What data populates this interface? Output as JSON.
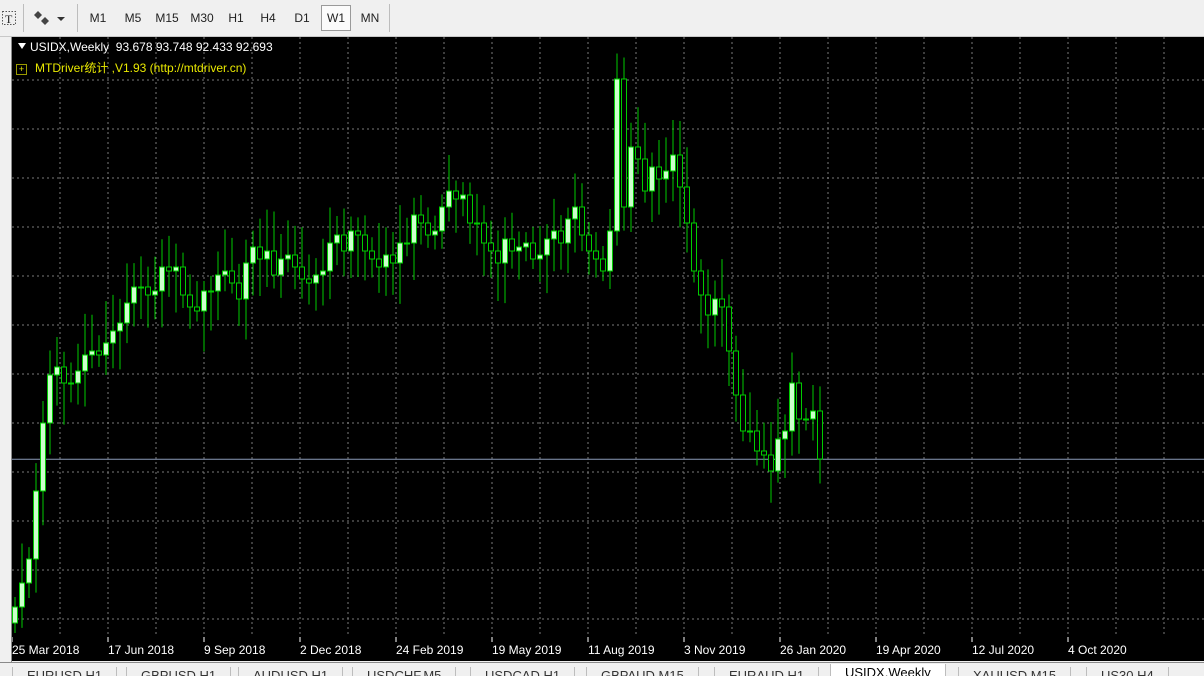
{
  "toolbar": {
    "timeframes": [
      {
        "label": "M1",
        "active": false
      },
      {
        "label": "M5",
        "active": false
      },
      {
        "label": "M15",
        "active": false
      },
      {
        "label": "M30",
        "active": false
      },
      {
        "label": "H1",
        "active": false
      },
      {
        "label": "H4",
        "active": false
      },
      {
        "label": "D1",
        "active": false
      },
      {
        "label": "W1",
        "active": true
      },
      {
        "label": "MN",
        "active": false
      }
    ]
  },
  "chart": {
    "header": "USIDX,Weekly  93.678 93.748 92.433 92.693",
    "indicator": "MTDriver统计 ,V1.93 (http://mtdriver.cn)",
    "colors": {
      "background": "#000000",
      "bull": "#ccffcc",
      "bear": "#000000",
      "wick": "#00cc00",
      "grid": "#7a7a7a",
      "axis_text": "#ffffff",
      "price_line": "#8a9ab8"
    }
  },
  "chart_data": {
    "type": "candlestick",
    "x_tick_labels": [
      "25 Mar 2018",
      "17 Jun 2018",
      "9 Sep 2018",
      "2 Dec 2018",
      "24 Feb 2019",
      "19 May 2019",
      "11 Aug 2019",
      "3 Nov 2019",
      "26 Jan 2020",
      "19 Apr 2020",
      "12 Jul 2020",
      "4 Oct 2020"
    ],
    "last_price": 92.693,
    "close_path": [
      89.0,
      89.6,
      90.2,
      91.9,
      93.6,
      94.8,
      95.0,
      94.6,
      94.6,
      94.9,
      95.3,
      95.4,
      95.3,
      95.6,
      95.9,
      96.1,
      96.6,
      97.0,
      97.0,
      96.8,
      96.9,
      97.5,
      97.4,
      97.5,
      96.8,
      96.5,
      96.4,
      96.9,
      96.9,
      97.3,
      97.4,
      97.1,
      96.7,
      97.6,
      98.0,
      97.7,
      97.9,
      97.3,
      97.7,
      97.8,
      97.5,
      97.2,
      97.1,
      97.3,
      97.4,
      98.1,
      98.3,
      97.9,
      98.4,
      98.3,
      97.9,
      97.7,
      97.5,
      97.8,
      97.6,
      98.1,
      98.1,
      98.8,
      98.6,
      98.3,
      98.4,
      99.0,
      99.4,
      99.2,
      99.3,
      98.6,
      98.6,
      98.1,
      97.9,
      97.6,
      98.2,
      97.9,
      98.0,
      98.1,
      97.7,
      97.8,
      98.2,
      98.4,
      98.1,
      98.7,
      99.0,
      98.3,
      97.9,
      97.7,
      97.4,
      98.4,
      102.2,
      99.0,
      100.5,
      100.2,
      99.4,
      100.0,
      99.7,
      99.9,
      100.3,
      99.5,
      98.6,
      97.4,
      96.8,
      96.3,
      96.7,
      96.5,
      95.4,
      94.3,
      93.4,
      93.4,
      92.9,
      92.8,
      92.4,
      93.2,
      93.4,
      94.6,
      93.7,
      93.7,
      93.9,
      92.7
    ],
    "y_range_estimate": [
      88.5,
      103.0
    ]
  },
  "bottom_tabs": [
    {
      "label": "EURUSD,H1",
      "active": false
    },
    {
      "label": "GBPUSD,H1",
      "active": false
    },
    {
      "label": "AUDUSD,H1",
      "active": false
    },
    {
      "label": "USDCHF,M5",
      "active": false
    },
    {
      "label": "USDCAD,H1",
      "active": false
    },
    {
      "label": "GBPAUD,M15",
      "active": false
    },
    {
      "label": "EURAUD,H1",
      "active": false
    },
    {
      "label": "USIDX,Weekly",
      "active": true
    },
    {
      "label": "XAUUSD,M15",
      "active": false
    },
    {
      "label": "US30,H4",
      "active": false
    }
  ]
}
